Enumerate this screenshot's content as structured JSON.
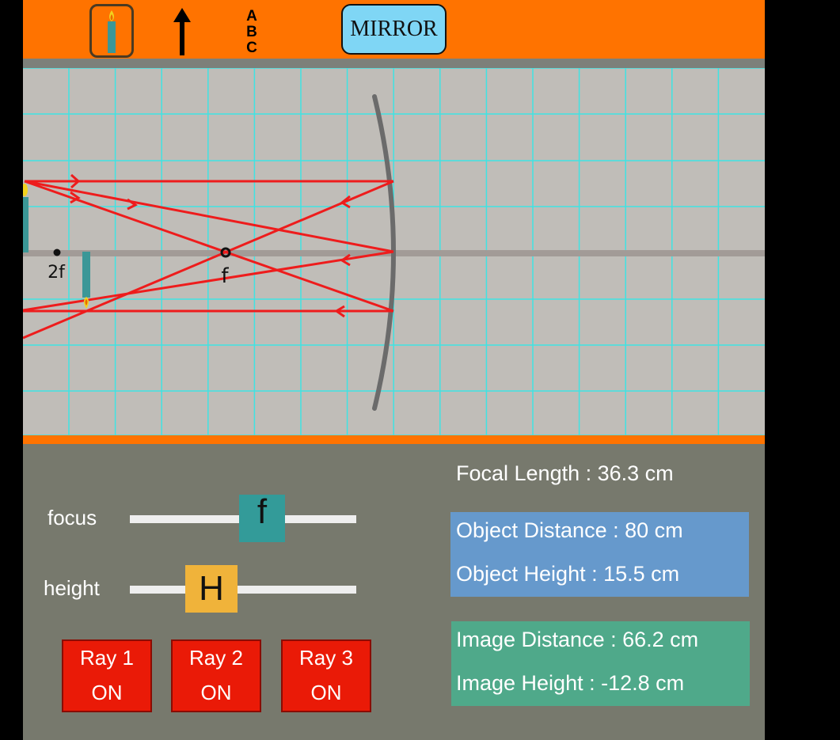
{
  "toolbar": {
    "tools": [
      "candle-object-tool",
      "arrow-object-tool",
      "letters-object-tool"
    ],
    "abc_letters": [
      "A",
      "B",
      "C"
    ],
    "mirror_label": "MIRROR",
    "active_tool": "candle-object-tool",
    "colors": {
      "bar": "#ff7300",
      "mirror_button": "#7fd6f5"
    }
  },
  "stage": {
    "point_labels": {
      "two_f": "2f",
      "f": "f"
    },
    "colors": {
      "background": "#c0bdb8",
      "grid": "#3fe3e3",
      "axis": "#a29b97",
      "ray": "#ee1c1c",
      "mirror": "#6b6b6b",
      "candle": "#3b9797"
    }
  },
  "controls": {
    "focus": {
      "label": "focus",
      "thumb_label": "f"
    },
    "height": {
      "label": "height",
      "thumb_label": "H"
    },
    "rays": [
      {
        "label": "Ray 1",
        "state": "ON"
      },
      {
        "label": "Ray 2",
        "state": "ON"
      },
      {
        "label": "Ray 3",
        "state": "ON"
      }
    ]
  },
  "info": {
    "focal_length": "Focal Length : 36.3 cm",
    "object_distance": "Object Distance : 80 cm",
    "object_height": "Object Height : 15.5 cm",
    "image_distance": "Image Distance : 66.2 cm",
    "image_height": "Image Height : -12.8 cm"
  }
}
